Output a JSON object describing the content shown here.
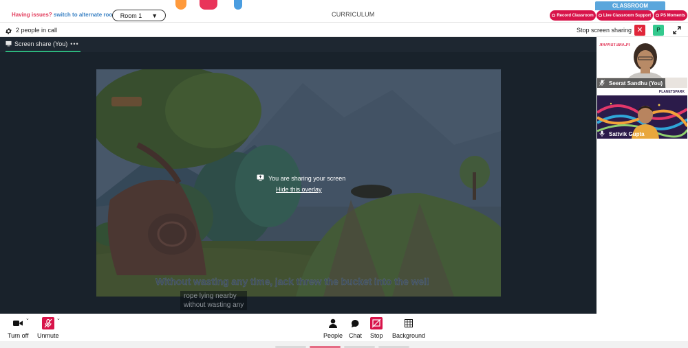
{
  "topbar": {
    "issues_text": "Having issues?",
    "alt_room_link": "switch to alternate room",
    "room_selected": "Room 1",
    "curriculum": "CURRICULUM",
    "classroom_tab": "CLASSROOM",
    "record_button": "Record Classroom",
    "support_button": "Live Classroom Support",
    "moments_button": "PS Moments"
  },
  "callbar": {
    "people_count": "2 people in call",
    "stop_sharing_label": "Stop screen sharing",
    "participant_initial": "P"
  },
  "stage": {
    "share_tab_label": "Screen share (You)",
    "more_label": "•••",
    "overlay_message": "You are sharing your screen",
    "overlay_link": "Hide this overlay",
    "caption": "Without wasting any time, jack threw the bucket into the well",
    "subtitle_line1": "rope lying nearby",
    "subtitle_line2": "without wasting any"
  },
  "participants": [
    {
      "name": "Seerat Sandhu (You)",
      "logo_text": "PLANETSPARK"
    },
    {
      "name": "Sattvik Gupta",
      "logo_text": "PLANETSPARK"
    }
  ],
  "controls": {
    "camera": "Turn off",
    "mic": "Unmute",
    "people": "People",
    "chat": "Chat",
    "stop": "Stop",
    "background": "Background"
  },
  "icons": {
    "settings": "gear-icon",
    "close": "close-icon",
    "expand": "expand-icon",
    "share": "screen-share-icon",
    "camera": "video-camera-icon",
    "mic": "mic-muted-icon",
    "people": "person-icon",
    "chat": "chat-bubble-icon",
    "stop": "stop-share-icon",
    "background": "background-grid-icon"
  },
  "colors": {
    "accent_red": "#d8144a",
    "accent_blue": "#5aa6dc",
    "accent_green": "#2db67d",
    "stage_bg": "#19222b"
  }
}
